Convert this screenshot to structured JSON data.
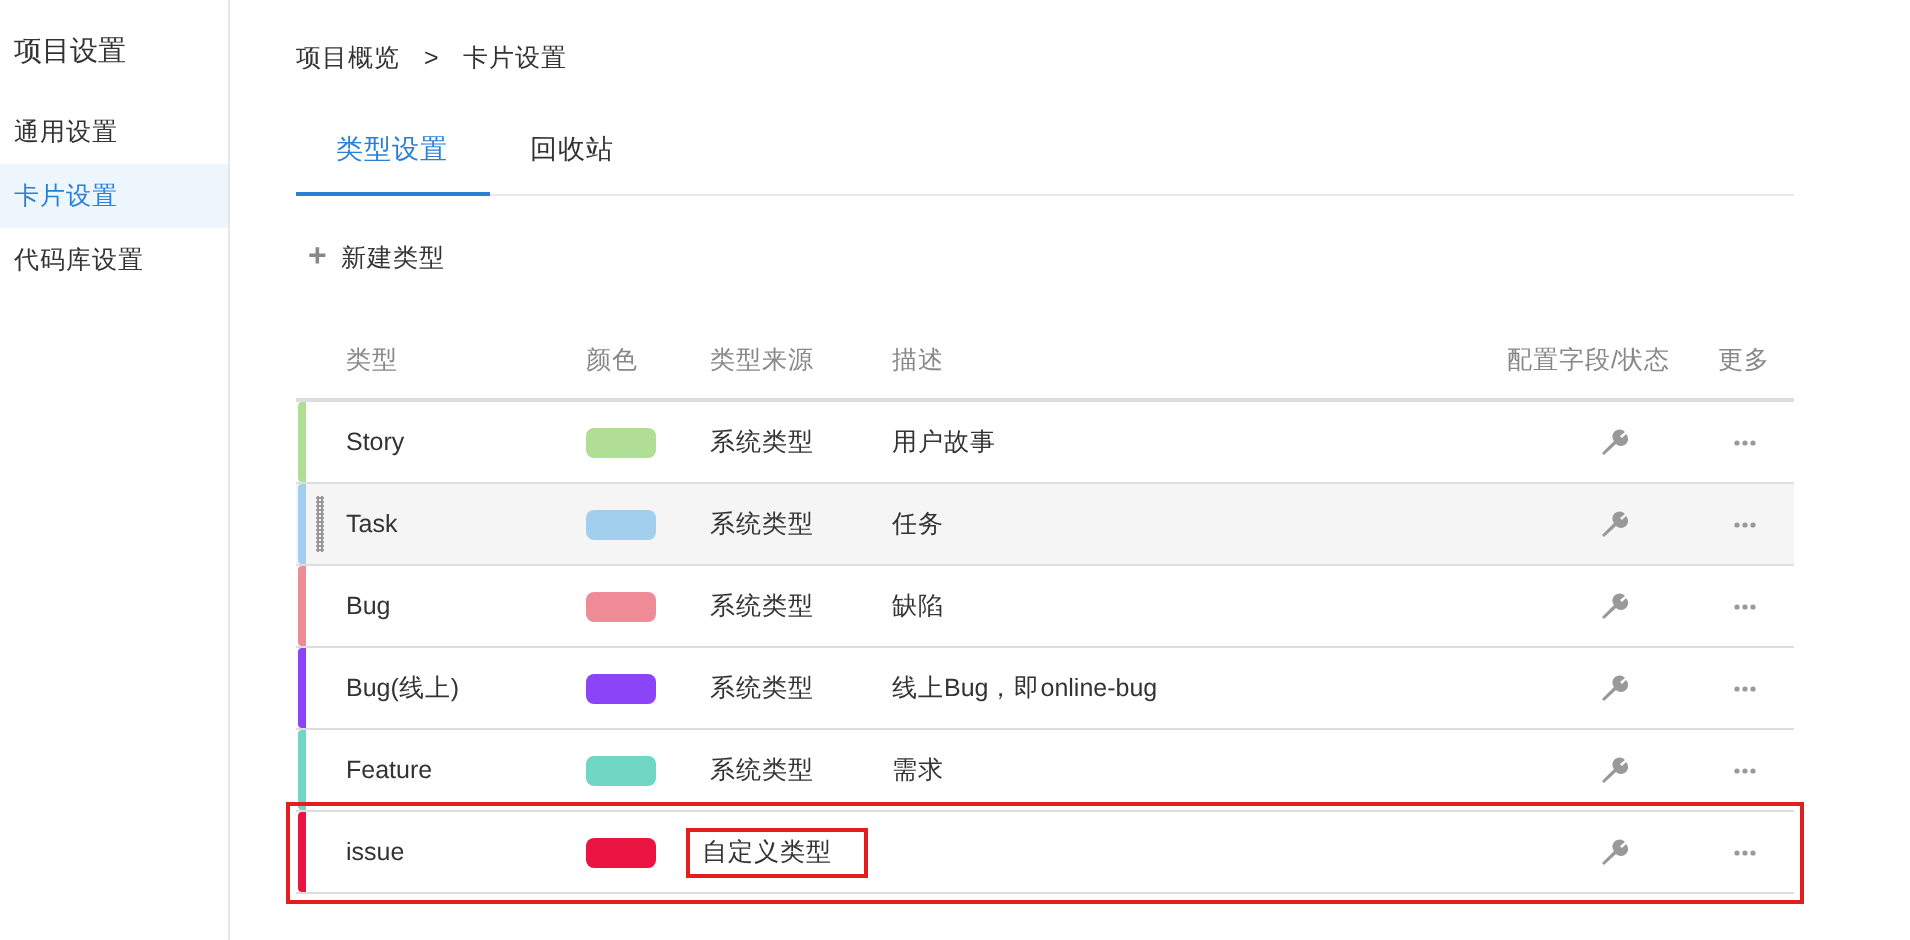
{
  "sidebar": {
    "title": "项目设置",
    "items": [
      {
        "label": "通用设置",
        "selected": false
      },
      {
        "label": "卡片设置",
        "selected": true
      },
      {
        "label": "代码库设置",
        "selected": false
      }
    ]
  },
  "breadcrumb": [
    "项目概览",
    ">",
    "卡片设置"
  ],
  "tabs": [
    {
      "label": "类型设置",
      "selected": true
    },
    {
      "label": "回收站",
      "selected": false
    }
  ],
  "new_button": {
    "icon": "+",
    "label": "新建类型"
  },
  "table": {
    "columns": [
      "类型",
      "颜色",
      "类型来源",
      "描述",
      "配置字段/状态",
      "更多"
    ],
    "rows": [
      {
        "type": "Story",
        "color": "#b0de95",
        "source": "系统类型",
        "description": "用户故事",
        "hovered": false,
        "highlighted": false,
        "source_highlighted": false
      },
      {
        "type": "Task",
        "color": "#a3cfee",
        "source": "系统类型",
        "description": "任务",
        "hovered": true,
        "highlighted": false,
        "source_highlighted": false
      },
      {
        "type": "Bug",
        "color": "#ef8b97",
        "source": "系统类型",
        "description": "缺陷",
        "hovered": false,
        "highlighted": false,
        "source_highlighted": false
      },
      {
        "type": "Bug(线上)",
        "color": "#8b44f8",
        "source": "系统类型",
        "description": "线上Bug，即online-bug",
        "hovered": false,
        "highlighted": false,
        "source_highlighted": false
      },
      {
        "type": "Feature",
        "color": "#6fd7c3",
        "source": "系统类型",
        "description": "需求",
        "hovered": false,
        "highlighted": false,
        "source_highlighted": false
      },
      {
        "type": "issue",
        "color": "#ea1440",
        "source": "自定义类型",
        "hovered": false,
        "highlighted": true,
        "source_highlighted": true
      }
    ]
  }
}
